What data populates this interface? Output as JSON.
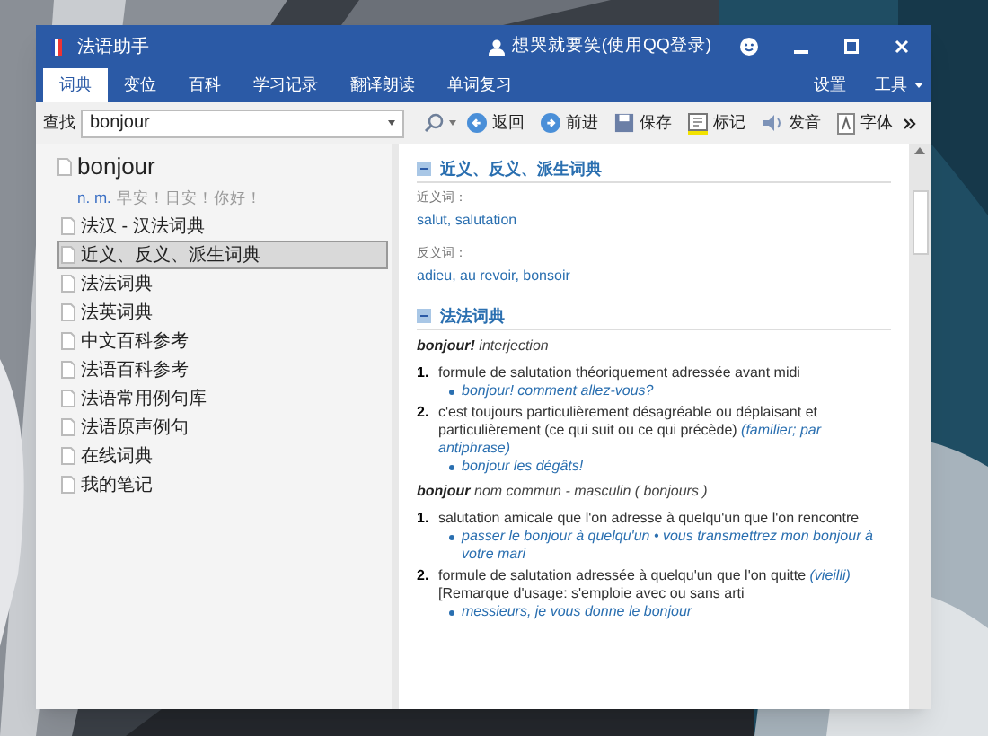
{
  "window": {
    "title": "法语助手",
    "user": "想哭就要笑(使用QQ登录)",
    "menu": [
      "设置",
      "工具"
    ]
  },
  "tabs": [
    {
      "label": "词典",
      "selected": true
    },
    {
      "label": "变位",
      "selected": false
    },
    {
      "label": "百科",
      "selected": false
    },
    {
      "label": "学习记录",
      "selected": false
    },
    {
      "label": "翻译朗读",
      "selected": false
    },
    {
      "label": "单词复习",
      "selected": false
    }
  ],
  "search": {
    "label": "查找",
    "value": "bonjour"
  },
  "toolbar": [
    {
      "label": "返回",
      "kind": "back"
    },
    {
      "label": "前进",
      "kind": "forward"
    },
    {
      "label": "保存",
      "kind": "save"
    },
    {
      "label": "标记",
      "kind": "mark"
    },
    {
      "label": "发音",
      "kind": "sound"
    },
    {
      "label": "字体",
      "kind": "font"
    }
  ],
  "headword": {
    "word": "bonjour",
    "pos": "n. m.",
    "gloss": "早安！日安！你好！"
  },
  "dictionaries": [
    {
      "label": "法汉 - 汉法词典",
      "selected": false
    },
    {
      "label": "近义、反义、派生词典",
      "selected": true
    },
    {
      "label": "法法词典",
      "selected": false
    },
    {
      "label": "法英词典",
      "selected": false
    },
    {
      "label": "中文百科参考",
      "selected": false
    },
    {
      "label": "法语百科参考",
      "selected": false
    },
    {
      "label": "法语常用例句库",
      "selected": false
    },
    {
      "label": "法语原声例句",
      "selected": false
    },
    {
      "label": "在线词典",
      "selected": false
    },
    {
      "label": "我的笔记",
      "selected": false
    }
  ],
  "sections": [
    {
      "kind": "thesaurus",
      "title": "近义、反义、派生词典",
      "expanded": true,
      "groups": [
        {
          "label": "近义词：",
          "words": "salut, salutation"
        },
        {
          "label": "反义词：",
          "words": "adieu, au revoir, bonsoir"
        }
      ]
    },
    {
      "kind": "definitions",
      "title": "法法词典",
      "expanded": true,
      "entries": [
        {
          "head": "bonjour!",
          "pos": "interjection",
          "senses": [
            {
              "num": "1.",
              "text": "formule de salutation théoriquement adressée avant midi",
              "examples": [
                "bonjour! comment allez-vous?"
              ]
            },
            {
              "num": "2.",
              "text": "c'est toujours particulièrement désagréable ou déplaisant et particulièrement (ce qui suit ou ce qui précède)",
              "note": "(familier; par antiphrase)",
              "examples": [
                "bonjour les dégâts!"
              ]
            }
          ]
        },
        {
          "head": "bonjour",
          "pos": "nom commun - masculin ( bonjours )",
          "senses": [
            {
              "num": "1.",
              "text": "salutation amicale que l'on adresse à quelqu'un que l'on rencontre",
              "examples": [
                "passer le bonjour à quelqu'un • vous transmettrez mon bonjour à votre mari"
              ]
            },
            {
              "num": "2.",
              "text": "formule de salutation adressée à quelqu'un que l'on quitte",
              "note": "(vieilli)",
              "remark": "[Remarque d'usage: s'emploie avec ou sans arti",
              "examples": [
                "messieurs, je vous donne le bonjour"
              ]
            }
          ]
        }
      ]
    }
  ]
}
